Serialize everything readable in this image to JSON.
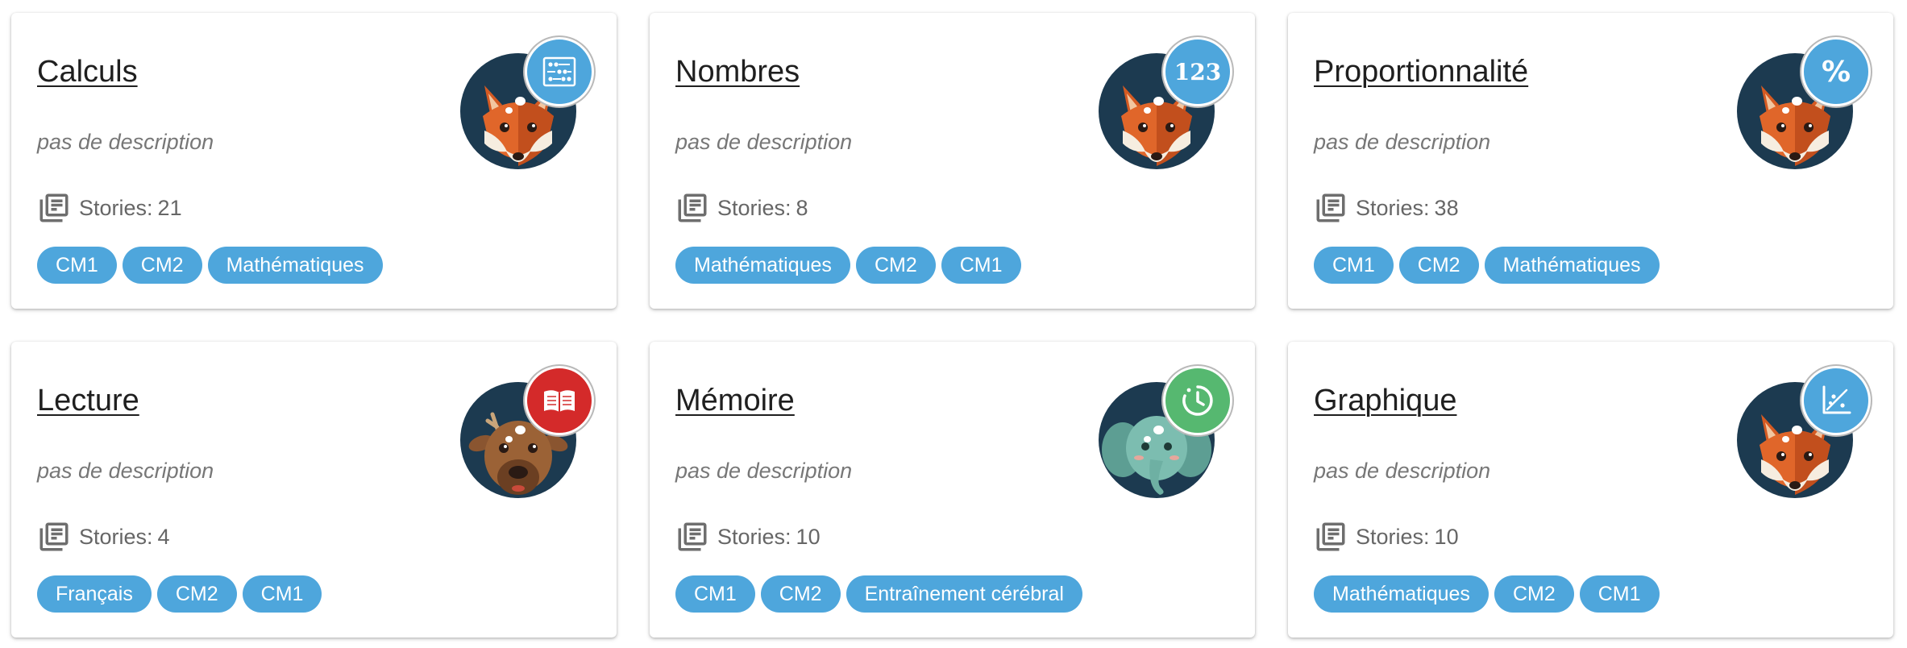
{
  "stories_label": "Stories:",
  "colors": {
    "tag": "#4ea6dc",
    "badge_blue": "#4ea6dc",
    "badge_red": "#d42a2a",
    "badge_green": "#56b870",
    "avatar_bg": "#1c3a50"
  },
  "cards": [
    {
      "title": "Calculs",
      "description": "pas de description",
      "stories": "21",
      "tags": [
        "CM1",
        "CM2",
        "Mathématiques"
      ],
      "badge_icon": "abacus-icon",
      "avatar": "fox"
    },
    {
      "title": "Nombres",
      "description": "pas de description",
      "stories": "8",
      "tags": [
        "Mathématiques",
        "CM2",
        "CM1"
      ],
      "badge_icon": "numbers-123-icon",
      "badge_text": "123",
      "avatar": "fox"
    },
    {
      "title": "Proportionnalité",
      "description": "pas de description",
      "stories": "38",
      "tags": [
        "CM1",
        "CM2",
        "Mathématiques"
      ],
      "badge_icon": "percent-icon",
      "badge_text": "%",
      "avatar": "fox"
    },
    {
      "title": "Lecture",
      "description": "pas de description",
      "stories": "4",
      "tags": [
        "Français",
        "CM2",
        "CM1"
      ],
      "badge_icon": "open-book-icon",
      "avatar": "deer"
    },
    {
      "title": "Mémoire",
      "description": "pas de description",
      "stories": "10",
      "tags": [
        "CM1",
        "CM2",
        "Entraînement cérébral"
      ],
      "badge_icon": "brain-clock-icon",
      "avatar": "elephant"
    },
    {
      "title": "Graphique",
      "description": "pas de description",
      "stories": "10",
      "tags": [
        "Mathématiques",
        "CM2",
        "CM1"
      ],
      "badge_icon": "chart-axes-icon",
      "avatar": "fox"
    }
  ]
}
